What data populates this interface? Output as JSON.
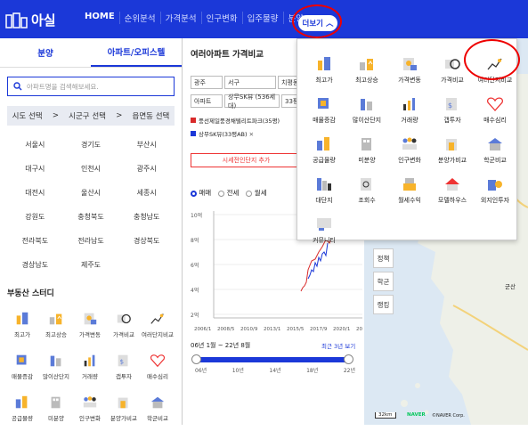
{
  "header": {
    "logo_text": "아실",
    "nav": [
      "HOME",
      "순위분석",
      "가격분석",
      "인구변화",
      "입주물량",
      "분양"
    ],
    "more_label": "더보기"
  },
  "left": {
    "tabs": [
      "분양",
      "아파트/오피스텔"
    ],
    "search_placeholder": "아파트명을 검색해보세요.",
    "region_bar": [
      "시도 선택",
      ">",
      "시군구 선택",
      ">",
      "읍면동 선택"
    ],
    "regions": [
      [
        "서울시",
        "경기도",
        "부산시"
      ],
      [
        "대구시",
        "인천시",
        "광주시"
      ],
      [
        "대전시",
        "울산시",
        "세종시"
      ],
      [
        "강원도",
        "충청북도",
        "충청남도"
      ],
      [
        "전라북도",
        "전라남도",
        "경상북도"
      ],
      [
        "경상남도",
        "제주도",
        ""
      ]
    ],
    "study_title": "부동산 스터디",
    "study_items": [
      "최고가",
      "최고상승",
      "가격변동",
      "가격비교",
      "여러단지비교",
      "매물증감",
      "많이산단지",
      "거래량",
      "갭투자",
      "매수심리",
      "공급물량",
      "미분양",
      "인구변화",
      "분양가비교",
      "학군비교"
    ]
  },
  "mid": {
    "title": "여러아파트 가격비교",
    "selects": {
      "sido": "광주",
      "sigungu": "서구",
      "dong": "치평동",
      "type": "아파트",
      "apt": "상무SK뷰 (536세대)",
      "size": "33평"
    },
    "apartments": [
      {
        "name": "풍선제일풍경채텔리트파크(35평)",
        "color": "#d92b2b"
      },
      {
        "name": "상무SK뷰(33평AB)",
        "color": "#1b38d8",
        "close": "✕"
      }
    ],
    "add_button": "시세전인단지 추가",
    "radios": [
      "매매",
      "전세",
      "월세"
    ],
    "y_ticks": [
      "10억",
      "8억",
      "6억",
      "4억",
      "2억"
    ],
    "x_ticks": [
      "2006/1",
      "2008/5",
      "2010/9",
      "2013/1",
      "2015/5",
      "2017/9",
      "2020/1",
      "2022/5"
    ],
    "period_label": "06년 1월 ~ 22년 8월",
    "recent_label": "최근 3년 보기",
    "slider_ticks": [
      "06년",
      "10년",
      "14년",
      "18년",
      "22년"
    ],
    "slider_range": [
      2006,
      2022
    ]
  },
  "popup": {
    "items": [
      "최고가",
      "최고상승",
      "가격변동",
      "가격비교",
      "여러단지비교",
      "매물증감",
      "많이산단지",
      "거래량",
      "갭투자",
      "매수심리",
      "공급물량",
      "미분양",
      "인구변화",
      "분양가비교",
      "학군비교",
      "대단지",
      "조회수",
      "월세수익",
      "모델하우스",
      "외지인투자",
      "커뮤니티"
    ]
  },
  "map": {
    "buttons": [
      "정책",
      "학군",
      "랭킹"
    ],
    "labels": [
      "군산",
      "NAVER",
      "©NAVER Corp."
    ],
    "scale": "32km"
  }
}
